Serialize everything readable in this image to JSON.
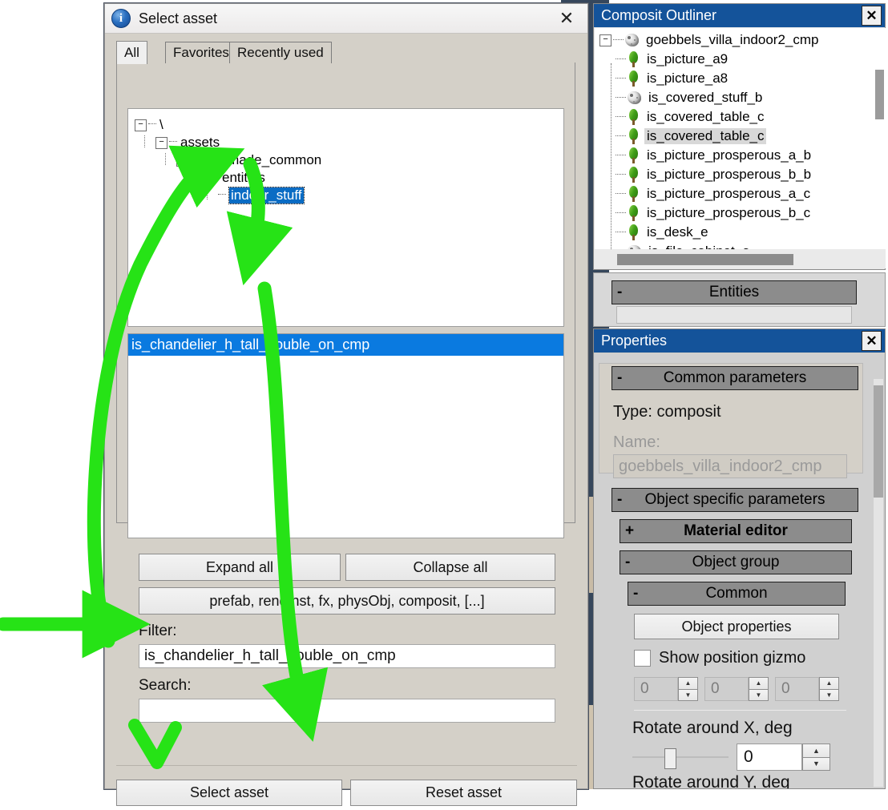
{
  "dialog": {
    "title": "Select asset",
    "close_label": "✕",
    "info_icon": "info-icon",
    "tabs": [
      {
        "label": "All",
        "active": true
      },
      {
        "label": "Favorites",
        "active": false
      },
      {
        "label": "Recently used",
        "active": false
      }
    ],
    "tree": [
      {
        "label": "\\",
        "depth": 0,
        "expander": "−",
        "selected": false
      },
      {
        "label": "assets",
        "depth": 1,
        "expander": "−",
        "selected": false
      },
      {
        "label": "manmade_common",
        "depth": 2,
        "expander": "−",
        "selected": false
      },
      {
        "label": "entities",
        "depth": 3,
        "expander": "−",
        "selected": false
      },
      {
        "label": "indoor_stuff",
        "depth": 4,
        "expander": "",
        "selected": true
      }
    ],
    "list": [
      {
        "label": "is_chandelier_h_tall_double_on_cmp",
        "selected": true
      }
    ],
    "buttons": {
      "expand_all": "Expand all",
      "collapse_all": "Collapse all",
      "types": "prefab, rendInst, fx, physObj, composit, [...]",
      "select_asset": "Select asset",
      "reset_asset": "Reset asset"
    },
    "filter": {
      "label": "Filter:",
      "value": "is_chandelier_h_tall_double_on_cmp",
      "placeholder": ""
    },
    "search": {
      "label": "Search:",
      "value": "",
      "placeholder": ""
    }
  },
  "outliner": {
    "title": "Composit Outliner",
    "close_label": "✕",
    "rows": [
      {
        "label": "goebbels_villa_indoor2_cmp",
        "icon": "rock-icon",
        "depth": 0,
        "expander": "−",
        "highlighted": false
      },
      {
        "label": "is_picture_a9",
        "icon": "tree-icon",
        "depth": 1,
        "expander": "",
        "highlighted": false
      },
      {
        "label": "is_picture_a8",
        "icon": "tree-icon",
        "depth": 1,
        "expander": "",
        "highlighted": false
      },
      {
        "label": "is_covered_stuff_b",
        "icon": "rock-icon",
        "depth": 1,
        "expander": "",
        "highlighted": false
      },
      {
        "label": "is_covered_table_c",
        "icon": "tree-icon",
        "depth": 1,
        "expander": "",
        "highlighted": false
      },
      {
        "label": "is_covered_table_c",
        "icon": "tree-icon",
        "depth": 1,
        "expander": "",
        "highlighted": true
      },
      {
        "label": "is_picture_prosperous_a_b",
        "icon": "tree-icon",
        "depth": 1,
        "expander": "",
        "highlighted": false
      },
      {
        "label": "is_picture_prosperous_b_b",
        "icon": "tree-icon",
        "depth": 1,
        "expander": "",
        "highlighted": false
      },
      {
        "label": "is_picture_prosperous_a_c",
        "icon": "tree-icon",
        "depth": 1,
        "expander": "",
        "highlighted": false
      },
      {
        "label": "is_picture_prosperous_b_c",
        "icon": "tree-icon",
        "depth": 1,
        "expander": "",
        "highlighted": false
      },
      {
        "label": "is_desk_e",
        "icon": "tree-icon",
        "depth": 1,
        "expander": "",
        "highlighted": false
      },
      {
        "label": "is_file_cabinet_a",
        "icon": "rock-icon",
        "depth": 1,
        "expander": "",
        "highlighted": false
      }
    ]
  },
  "entities_panel": {
    "header": "Entities",
    "sign": "-"
  },
  "properties": {
    "title": "Properties",
    "close_label": "✕",
    "common_parameters": {
      "header": "Common parameters",
      "sign": "-"
    },
    "type_line": "Type: composit",
    "name_label": "Name:",
    "name_value": "goebbels_villa_indoor2_cmp",
    "object_specific": {
      "header": "Object specific parameters",
      "sign": "-"
    },
    "material_editor": {
      "header": "Material editor",
      "sign": "+"
    },
    "object_group": {
      "header": "Object group",
      "sign": "-"
    },
    "common": {
      "header": "Common",
      "sign": "-"
    },
    "object_properties_button": "Object properties",
    "show_position_gizmo": {
      "label": "Show position gizmo",
      "checked": false
    },
    "position": {
      "x": "0",
      "y": "0",
      "z": "0"
    },
    "rotate_x": {
      "label": "Rotate around X, deg",
      "value": "0"
    },
    "rotate_y": {
      "label": "Rotate around Y, deg"
    },
    "spinner_up": "▲",
    "spinner_down": "▼"
  },
  "colors": {
    "title_blue": "#14539A",
    "selection_blue": "#0A7AE0",
    "tree_selection_blue": "#0A6CC4",
    "annotation_green": "#26E316",
    "panel_gray": "#D4D0C8",
    "group_header_gray": "#8C8C8C"
  }
}
